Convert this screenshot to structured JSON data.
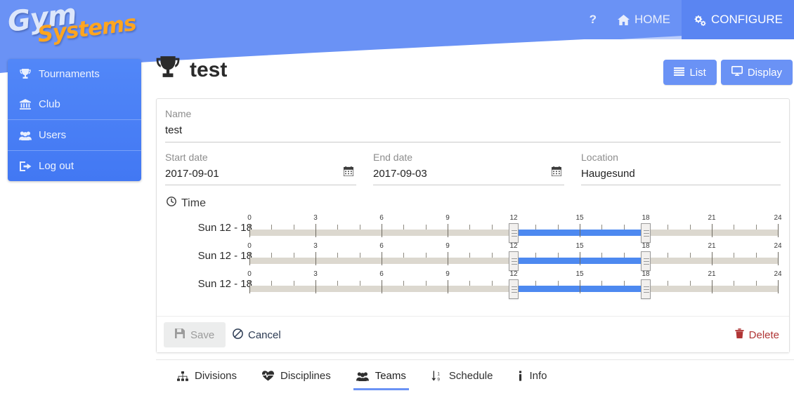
{
  "brand": {
    "line1": "Gym",
    "line2": "Systems",
    "color1": "#dce6fb",
    "color2": "#ffa51f"
  },
  "topnav": {
    "help_label": "?",
    "items": [
      {
        "label": "HOME",
        "icon": "home-icon",
        "active": false
      },
      {
        "label": "CONFIGURE",
        "icon": "gears-icon",
        "active": true
      }
    ]
  },
  "sidebar": {
    "items": [
      {
        "label": "Tournaments",
        "icon": "trophy-icon"
      },
      {
        "label": "Club",
        "icon": "bank-icon"
      },
      {
        "label": "Users",
        "icon": "users-icon"
      },
      {
        "label": "Log out",
        "icon": "sign-out-icon"
      }
    ]
  },
  "page": {
    "title": "test",
    "title_icon": "trophy-icon",
    "buttons": [
      {
        "label": "List",
        "icon": "list-icon"
      },
      {
        "label": "Display",
        "icon": "desktop-icon"
      }
    ]
  },
  "form": {
    "name": {
      "label": "Name",
      "value": "test"
    },
    "start_date": {
      "label": "Start date",
      "value": "2017-09-01",
      "icon": "calendar-icon"
    },
    "end_date": {
      "label": "End date",
      "value": "2017-09-03",
      "icon": "calendar-icon"
    },
    "location": {
      "label": "Location",
      "value": "Haugesund"
    }
  },
  "time": {
    "section_label": "Time",
    "section_icon": "clock-icon",
    "axis": {
      "min": 0,
      "max": 24,
      "major_ticks": [
        0,
        3,
        6,
        9,
        12,
        15,
        18,
        21,
        24
      ],
      "tick_labels": [
        "0",
        "3",
        "6",
        "9",
        "12",
        "15",
        "18",
        "21",
        "24"
      ],
      "minor_step": 1
    },
    "rows": [
      {
        "day": "Sun",
        "range_label": "12 - 18",
        "start": 12,
        "end": 18
      },
      {
        "day": "Sun",
        "range_label": "12 - 18",
        "start": 12,
        "end": 18
      },
      {
        "day": "Sun",
        "range_label": "12 - 18",
        "start": 12,
        "end": 18
      }
    ]
  },
  "actions": {
    "save": {
      "label": "Save",
      "icon": "save-icon",
      "disabled": true
    },
    "cancel": {
      "label": "Cancel",
      "icon": "ban-icon"
    },
    "delete": {
      "label": "Delete",
      "icon": "trash-icon",
      "color": "#b03535"
    }
  },
  "tabs": [
    {
      "label": "Divisions",
      "icon": "sitemap-icon",
      "active": false
    },
    {
      "label": "Disciplines",
      "icon": "heartbeat-icon",
      "active": false
    },
    {
      "label": "Teams",
      "icon": "users-icon",
      "active": true
    },
    {
      "label": "Schedule",
      "icon": "sort-numeric-icon",
      "active": false
    },
    {
      "label": "Info",
      "icon": "info-icon",
      "active": false
    }
  ],
  "colors": {
    "header_blue": "#6a92f5",
    "accent_blue": "#4d89f0",
    "sidebar_blue": "#4c82f7",
    "track": "#dcd8cf"
  }
}
